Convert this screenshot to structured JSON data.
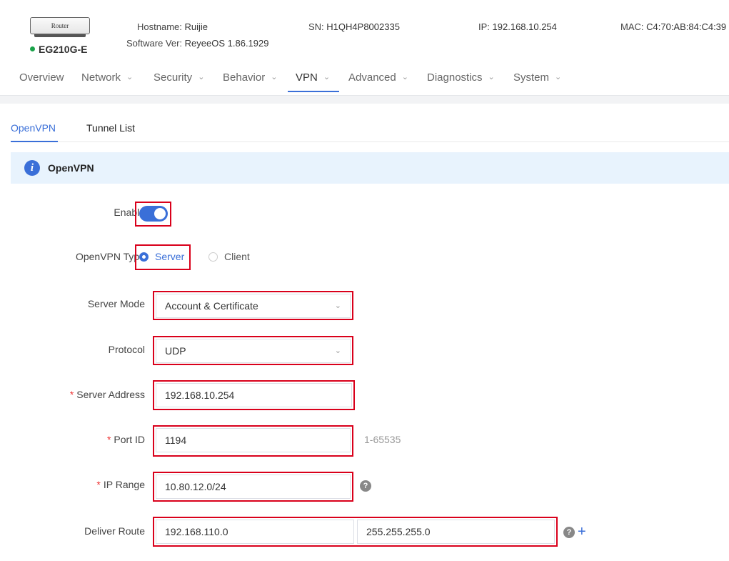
{
  "device": {
    "icon_label": "Router",
    "model": "EG210G-E",
    "status_color": "#1aa34a"
  },
  "info": {
    "hostname_label": "Hostname:",
    "hostname": "Ruijie",
    "software_label": "Software Ver:",
    "software": "ReyeeOS 1.86.1929",
    "sn_label": "SN:",
    "sn": "H1QH4P8002335",
    "ip_label": "IP:",
    "ip": "192.168.10.254",
    "mac_label": "MAC:",
    "mac": "C4:70:AB:84:C4:39"
  },
  "nav": [
    {
      "label": "Overview",
      "dropdown": false
    },
    {
      "label": "Network",
      "dropdown": true
    },
    {
      "label": "Security",
      "dropdown": true
    },
    {
      "label": "Behavior",
      "dropdown": true
    },
    {
      "label": "VPN",
      "dropdown": true,
      "active": true
    },
    {
      "label": "Advanced",
      "dropdown": true
    },
    {
      "label": "Diagnostics",
      "dropdown": true
    },
    {
      "label": "System",
      "dropdown": true
    }
  ],
  "tabs": [
    {
      "label": "OpenVPN",
      "active": true
    },
    {
      "label": "Tunnel List",
      "active": false
    }
  ],
  "banner": {
    "title": "OpenVPN",
    "icon": "info-icon"
  },
  "form": {
    "enable_label": "Enable",
    "enable_value": true,
    "type_label": "OpenVPN Type",
    "type_options": [
      "Server",
      "Client"
    ],
    "type_selected": "Server",
    "server_mode_label": "Server Mode",
    "server_mode_value": "Account & Certificate",
    "protocol_label": "Protocol",
    "protocol_value": "UDP",
    "server_address_label": "Server Address",
    "server_address_value": "192.168.10.254",
    "port_label": "Port ID",
    "port_value": "1194",
    "port_hint": "1-65535",
    "ip_range_label": "IP Range",
    "ip_range_value": "10.80.12.0/24",
    "deliver_route_label": "Deliver Route",
    "deliver_route_ip": "192.168.110.0",
    "deliver_route_mask": "255.255.255.0",
    "required_mark": "*",
    "help_mark": "?",
    "add_mark": "+"
  },
  "colors": {
    "accent": "#3a6fd8",
    "highlight": "#d9001b",
    "banner_bg": "#e8f3fd"
  }
}
